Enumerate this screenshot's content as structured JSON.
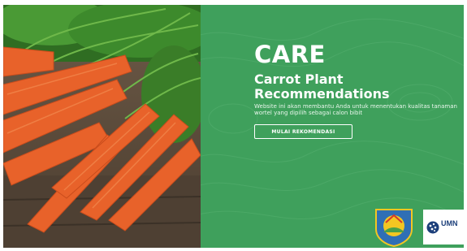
{
  "hero": {
    "image_subject": "carrots-photo",
    "title": "CARE",
    "subtitle": "Carrot Plant Recommendations",
    "description": "Website ini akan membantu Anda untuk menentukan kualitas tanaman wortel yang dipilih sebagai calon bibit",
    "cta_label": "MULAI REKOMENDASI"
  },
  "logos": {
    "secondary_label": "UMN"
  },
  "colors": {
    "panel_green": "#3fa05c",
    "carrot_orange": "#e8622a",
    "leaf_green": "#3f8a2e",
    "wood_brown": "#5a4a3a",
    "umn_blue": "#1c3f7a"
  }
}
